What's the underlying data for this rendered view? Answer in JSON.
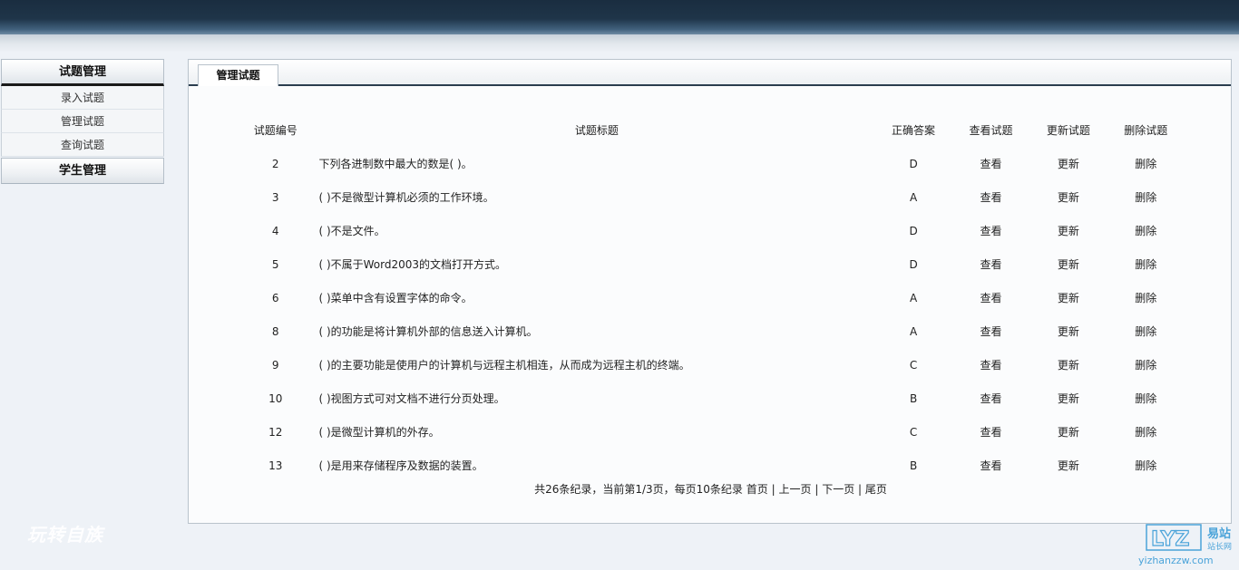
{
  "sidebar": {
    "section1": "试题管理",
    "items": [
      "录入试题",
      "管理试题",
      "查询试题"
    ],
    "section2": "学生管理"
  },
  "panel": {
    "tab": "管理试题"
  },
  "table": {
    "headers": {
      "id": "试题编号",
      "title": "试题标题",
      "answer": "正确答案",
      "view": "查看试题",
      "update": "更新试题",
      "delete": "删除试题"
    },
    "action_labels": {
      "view": "查看",
      "update": "更新",
      "delete": "删除"
    },
    "rows": [
      {
        "id": "2",
        "title": "下列各进制数中最大的数是( )。",
        "answer": "D"
      },
      {
        "id": "3",
        "title": "( )不是微型计算机必须的工作环境。",
        "answer": "A"
      },
      {
        "id": "4",
        "title": "( )不是文件。",
        "answer": "D"
      },
      {
        "id": "5",
        "title": "( )不属于Word2003的文档打开方式。",
        "answer": "D"
      },
      {
        "id": "6",
        "title": "( )菜单中含有设置字体的命令。",
        "answer": "A"
      },
      {
        "id": "8",
        "title": "( )的功能是将计算机外部的信息送入计算机。",
        "answer": "A"
      },
      {
        "id": "9",
        "title": "( )的主要功能是使用户的计算机与远程主机相连，从而成为远程主机的终端。",
        "answer": "C"
      },
      {
        "id": "10",
        "title": "( )视图方式可对文档不进行分页处理。",
        "answer": "B"
      },
      {
        "id": "12",
        "title": "( )是微型计算机的外存。",
        "answer": "C"
      },
      {
        "id": "13",
        "title": "( )是用来存储程序及数据的装置。",
        "answer": "B"
      }
    ]
  },
  "pager": {
    "summary": "共26条纪录，当前第1/3页，每页10条纪录",
    "first": "首页",
    "prev": "上一页",
    "next": "下一页",
    "last": "尾页",
    "sep": "|"
  },
  "watermarks": {
    "left": "玩转自族",
    "right_cn1": "易站",
    "right_cn2": "站长网",
    "right_url": "yizhanzzw.com"
  }
}
